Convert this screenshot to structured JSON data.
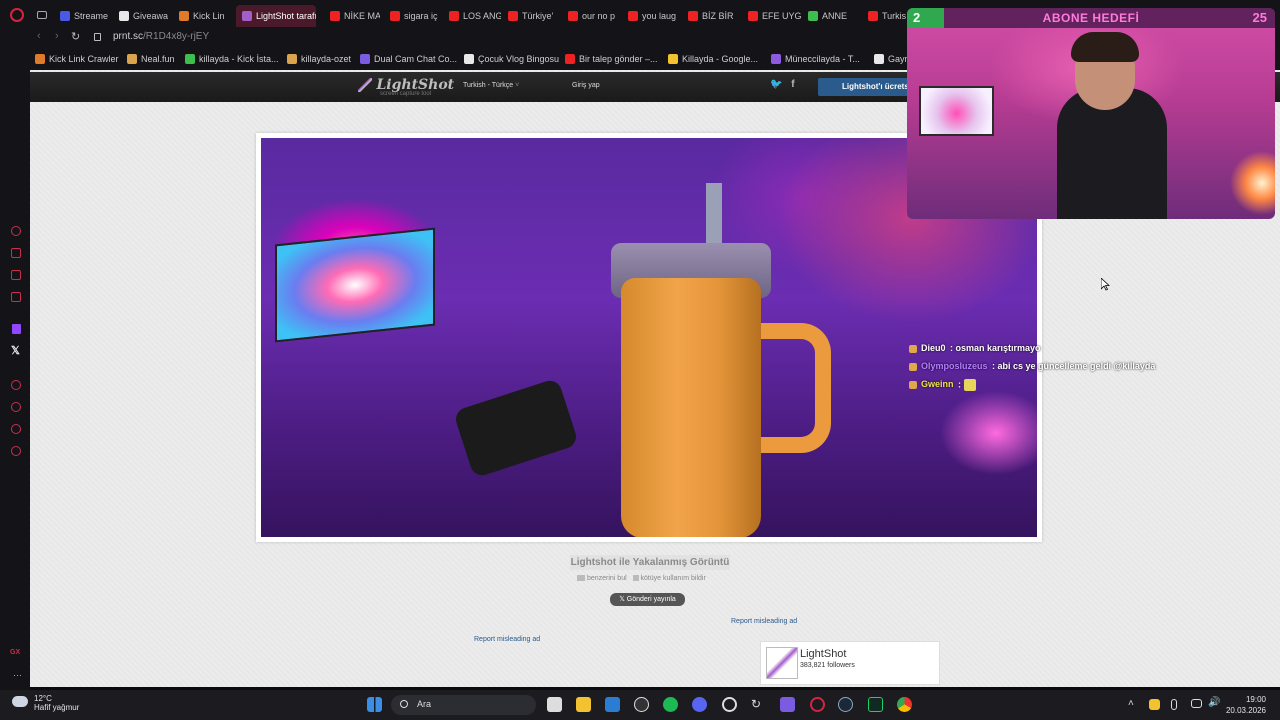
{
  "browser": {
    "tabs": [
      {
        "label": "Streame",
        "color": "#4a5ae6"
      },
      {
        "label": "Giveawa",
        "color": "#e8e8e8"
      },
      {
        "label": "Kick Lin",
        "color": "#e07a2b"
      },
      {
        "label": "LightShot tarafın",
        "color": "#a35fc9",
        "active": true
      },
      {
        "label": "NİKE MA",
        "color": "#e22"
      },
      {
        "label": "sigara iç",
        "color": "#e22"
      },
      {
        "label": "LOS ANG",
        "color": "#e22"
      },
      {
        "label": "Türkiye'",
        "color": "#e22"
      },
      {
        "label": "our no p",
        "color": "#e22"
      },
      {
        "label": "you laug",
        "color": "#e22"
      },
      {
        "label": "BİZ BİR",
        "color": "#e22"
      },
      {
        "label": "EFE UYG",
        "color": "#e22"
      },
      {
        "label": "ANNE",
        "color": "#3cbf4e"
      },
      {
        "label": "Turkis",
        "color": "#e22"
      }
    ],
    "url_host": "prnt.sc",
    "url_path": "/R1D4x8y-rjEY",
    "bookmarks": [
      {
        "label": "Kick Link Crawler",
        "color": "#e07a2b"
      },
      {
        "label": "Neal.fun",
        "color": "#d9a54c"
      },
      {
        "label": "killayda - Kick İsta...",
        "color": "#3cbf4e"
      },
      {
        "label": "killayda-ozet",
        "color": "#d9a54c"
      },
      {
        "label": "Dual Cam Chat Co...",
        "color": "#7b5be0"
      },
      {
        "label": "Çocuk Vlog Bingosu",
        "color": "#e8e8e8"
      },
      {
        "label": "Bir talep gönder –...",
        "color": "#e22"
      },
      {
        "label": "Killayda - Google...",
        "color": "#f2c230"
      },
      {
        "label": "Müneccilayda - T...",
        "color": "#8e5be0"
      },
      {
        "label": "Gayri",
        "color": "#e8e8e8"
      }
    ]
  },
  "lightshot": {
    "logo": "LightShot",
    "tagline": "screen capture tool",
    "language": "Turkish - Türkçe",
    "login": "Giriş yap",
    "cta": "Lightshot'ı ücretsiz",
    "caption": "Lightshot ile Yakalanmış Görüntü",
    "similar": "benzerini bul",
    "report_abuse": "kötüye kullanım bildir",
    "tweet": "Gönderi yayınla",
    "report_ad_right": "Report misleading ad",
    "report_ad_left": "Report misleading ad",
    "fb_name": "LightShot",
    "fb_followers": "383,821 followers"
  },
  "chat": [
    {
      "user": "Dieu0",
      "msg": "osman karıştırmayo",
      "color": "#ffffff"
    },
    {
      "user": "Olymposluzeus",
      "msg": "abi cs ye güncelleme geldi @killayda",
      "color": "#b57dff"
    },
    {
      "user": "Gweinn",
      "msg": "",
      "color": "#f2e34a"
    }
  ],
  "webcam": {
    "goal_left": "2",
    "goal_title": "ABONE HEDEFİ",
    "goal_right": "25"
  },
  "taskbar": {
    "temp": "12°C",
    "weather": "Hafif yağmur",
    "search": "Ara",
    "time": "19:00",
    "date": "20.03.2026"
  }
}
